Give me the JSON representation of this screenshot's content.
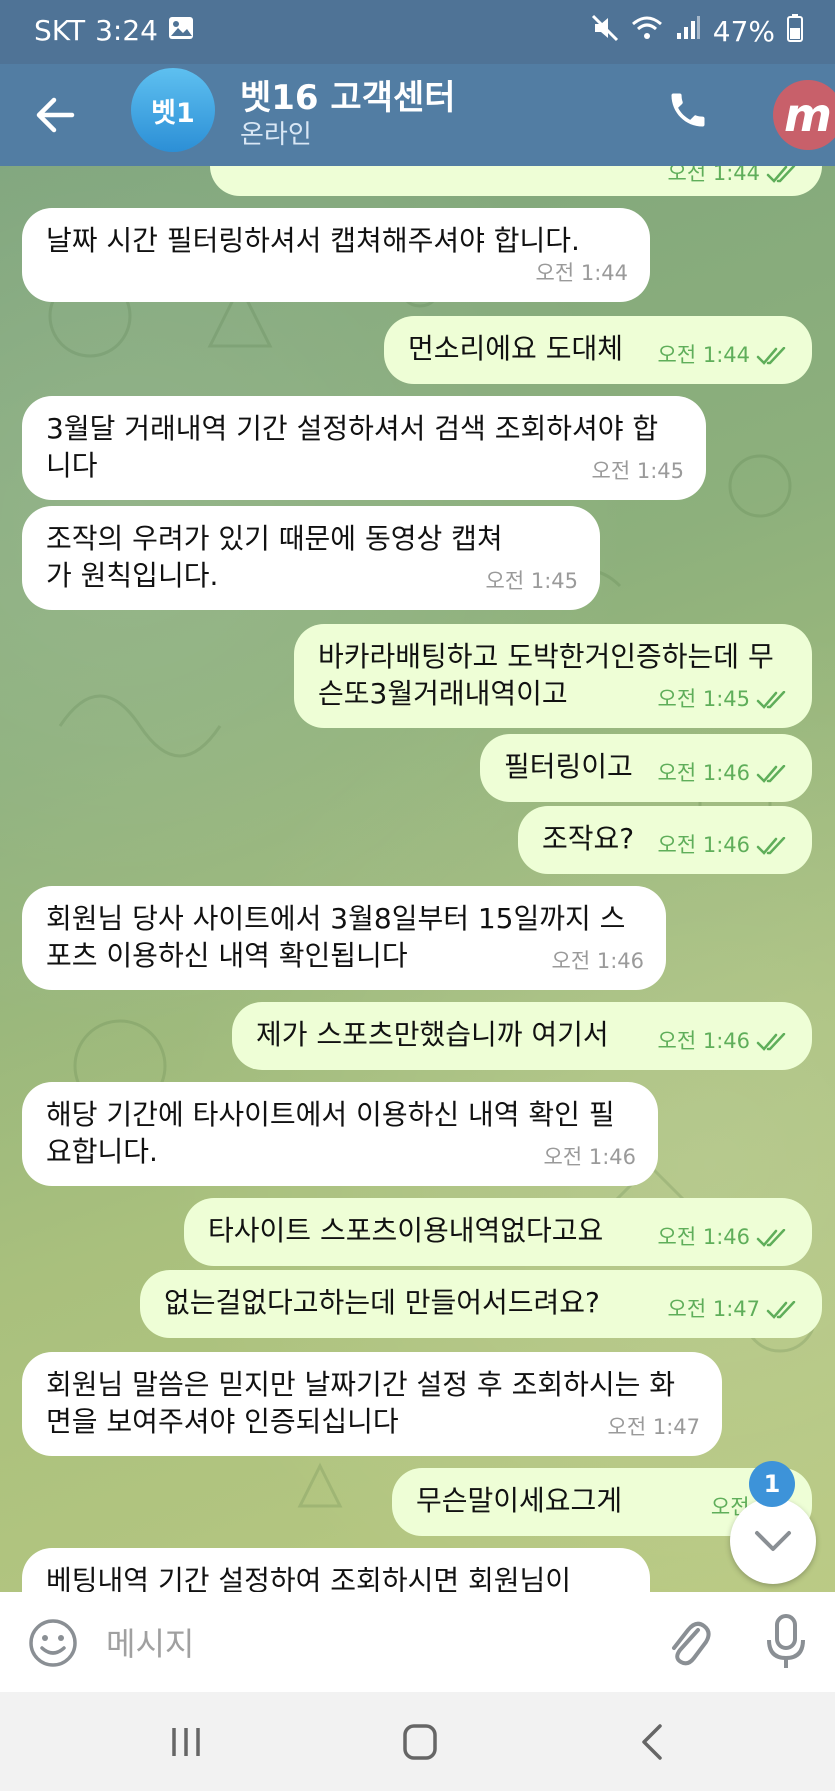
{
  "status_bar": {
    "carrier": "SKT",
    "time": "3:24",
    "battery": "47%"
  },
  "header": {
    "avatar_text": "벳1",
    "title": "벳16 고객센터",
    "status": "온라인",
    "badge_letter": "m"
  },
  "colors": {
    "header": "#527da3",
    "incoming_bubble": "#ffffff",
    "outgoing_bubble": "#eefed6",
    "check_green": "#5fae5a",
    "badge_blue": "#3d93d9"
  },
  "messages": [
    {
      "side": "out",
      "text": "",
      "time": "오전 1:44",
      "read": true
    },
    {
      "side": "in",
      "text": "날짜 시간 필터링하셔서 캡쳐해주셔야 합니다.",
      "time": "오전 1:44"
    },
    {
      "side": "out",
      "text": "먼소리에요 도대체",
      "time": "오전 1:44",
      "read": true
    },
    {
      "side": "in",
      "text": "3월달 거래내역 기간 설정하셔서 검색 조회하셔야 합니다",
      "time": "오전 1:45"
    },
    {
      "side": "in",
      "text": "조작의 우려가 있기 때문에 동영상 캡쳐가 원칙입니다.",
      "time": "오전 1:45"
    },
    {
      "side": "out",
      "text": "바카라배팅하고 도박한거인증하는데 무슨또3월거래내역이고",
      "time": "오전 1:45",
      "read": true
    },
    {
      "side": "out",
      "text": "필터링이고",
      "time": "오전 1:46",
      "read": true
    },
    {
      "side": "out",
      "text": "조작요?",
      "time": "오전 1:46",
      "read": true
    },
    {
      "side": "in",
      "text": "회원님 당사 사이트에서 3월8일부터 15일까지 스포츠 이용하신 내역 확인됩니다",
      "time": "오전 1:46"
    },
    {
      "side": "out",
      "text": "제가 스포츠만했습니까 여기서",
      "time": "오전 1:46",
      "read": true
    },
    {
      "side": "in",
      "text": "해당 기간에 타사이트에서 이용하신 내역 확인 필요합니다.",
      "time": "오전 1:46"
    },
    {
      "side": "out",
      "text": "타사이트 스포츠이용내역없다고요",
      "time": "오전 1:46",
      "read": true
    },
    {
      "side": "out",
      "text": "없는걸없다고하는데 만들어서드려요?",
      "time": "오전 1:47",
      "read": true
    },
    {
      "side": "in",
      "text": "회원님 말씀은 믿지만 날짜기간 설정 후 조회하시는 화면을 보여주셔야 인증되십니다",
      "time": "오전 1:47"
    },
    {
      "side": "out",
      "text": "무슨말이세요그게",
      "time": "오전 1:4",
      "read": true
    },
    {
      "side": "in",
      "text": "베팅내역 기간 설정하여 조회하시면 회원님이",
      "time": ""
    }
  ],
  "scroll": {
    "unread_count": "1"
  },
  "composer": {
    "placeholder": "메시지"
  }
}
